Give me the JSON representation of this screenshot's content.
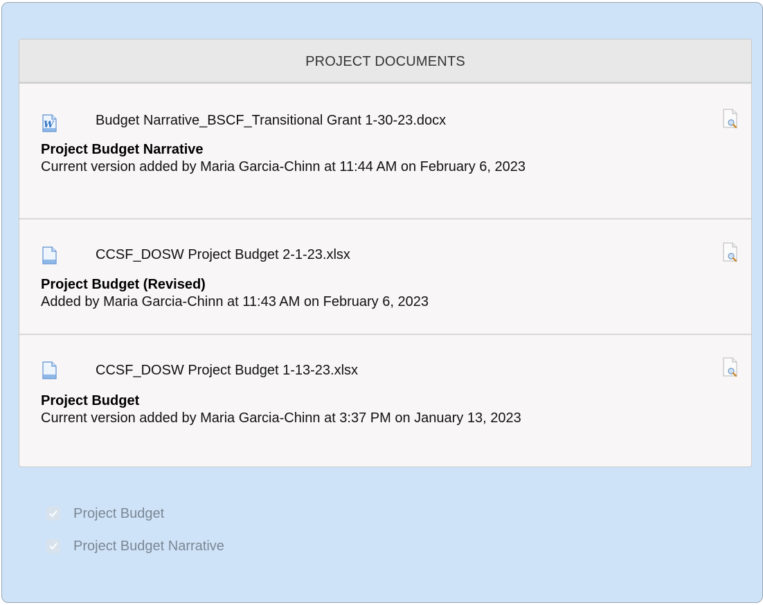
{
  "panel": {
    "title": "PROJECT DOCUMENTS"
  },
  "documents": [
    {
      "file_name": "Budget Narrative_BSCF_Transitional Grant 1-30-23.docx",
      "file_icon": "word-document-icon",
      "title": "Project Budget Narrative",
      "meta": "Current version added by Maria Garcia-Chinn at 11:44 AM on February 6, 2023",
      "preview_icon": "preview-icon"
    },
    {
      "file_name": "CCSF_DOSW Project Budget 2-1-23.xlsx",
      "file_icon": "document-icon",
      "title": "Project Budget (Revised)",
      "meta": "Added by Maria Garcia-Chinn at 11:43 AM on February 6, 2023",
      "preview_icon": "preview-icon"
    },
    {
      "file_name": "CCSF_DOSW Project Budget 1-13-23.xlsx",
      "file_icon": "document-icon",
      "title": "Project Budget",
      "meta": "Current version added by Maria Garcia-Chinn at 3:37 PM on January 13, 2023",
      "preview_icon": "preview-icon"
    }
  ],
  "checklist": [
    {
      "label": "Project Budget",
      "checked": true,
      "disabled": true
    },
    {
      "label": "Project Budget Narrative",
      "checked": true,
      "disabled": true
    }
  ],
  "colors": {
    "background": "#cfe3f8",
    "panel": "#f8f6f7",
    "header": "#e8e8e8"
  }
}
